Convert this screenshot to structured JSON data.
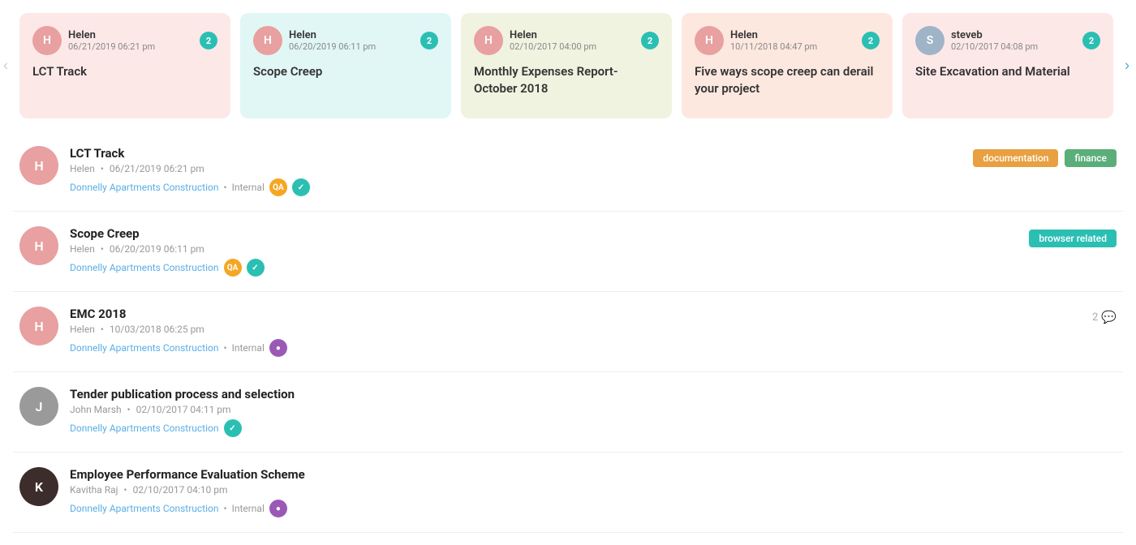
{
  "carousel": {
    "cards": [
      {
        "id": "card-1",
        "user": "Helen",
        "date": "06/21/2019 06:21 pm",
        "title": "LCT Track",
        "badge": "2",
        "bg": "card-pink",
        "avatarColor": "#E8A0A0",
        "avatarInitial": "H"
      },
      {
        "id": "card-2",
        "user": "Helen",
        "date": "06/20/2019 06:11 pm",
        "title": "Scope Creep",
        "badge": "2",
        "bg": "card-teal",
        "avatarColor": "#E8A0A0",
        "avatarInitial": "H"
      },
      {
        "id": "card-3",
        "user": "Helen",
        "date": "02/10/2017 04:00 pm",
        "title": "Monthly Expenses Report- October 2018",
        "badge": "2",
        "bg": "card-olive",
        "avatarColor": "#E8A0A0",
        "avatarInitial": "H"
      },
      {
        "id": "card-4",
        "user": "Helen",
        "date": "10/11/2018 04:47 pm",
        "title": "Five ways scope creep can derail your project",
        "badge": "2",
        "bg": "card-peach",
        "avatarColor": "#E8A0A0",
        "avatarInitial": "H"
      },
      {
        "id": "card-5",
        "user": "steveb",
        "date": "02/10/2017 04:08 pm",
        "title": "Site Excavation and Material",
        "badge": "2",
        "bg": "card-pink2",
        "avatarColor": "#A0B4C8",
        "avatarInitial": "S"
      }
    ]
  },
  "list": {
    "items": [
      {
        "id": "item-1",
        "title": "LCT Track",
        "user": "Helen",
        "date": "06/21/2019 06:21 pm",
        "project": "Donnelly Apartments Construction",
        "internal": true,
        "avatarColor": "#E8A0A0",
        "avatarInitial": "H",
        "pills": [
          {
            "label": "QA",
            "color": "pill-orange"
          },
          {
            "label": "",
            "color": "pill-teal",
            "icon": "✓"
          }
        ],
        "tags": [
          {
            "label": "documentation",
            "class": "tag-documentation"
          },
          {
            "label": "finance",
            "class": "tag-finance"
          }
        ],
        "comments": null
      },
      {
        "id": "item-2",
        "title": "Scope Creep",
        "user": "Helen",
        "date": "06/20/2019 06:11 pm",
        "project": "Donnelly Apartments Construction",
        "internal": false,
        "avatarColor": "#E8A0A0",
        "avatarInitial": "H",
        "pills": [
          {
            "label": "QA",
            "color": "pill-orange"
          },
          {
            "label": "",
            "color": "pill-teal",
            "icon": "✓"
          }
        ],
        "tags": [
          {
            "label": "browser related",
            "class": "tag-browser"
          }
        ],
        "comments": null
      },
      {
        "id": "item-3",
        "title": "EMC 2018",
        "user": "Helen",
        "date": "10/03/2018 06:25 pm",
        "project": "Donnelly Apartments Construction",
        "internal": true,
        "avatarColor": "#E8A0A0",
        "avatarInitial": "H",
        "pills": [
          {
            "label": "",
            "color": "pill-purple",
            "icon": "♦"
          }
        ],
        "tags": [],
        "comments": "2"
      },
      {
        "id": "item-4",
        "title": "Tender publication process and selection",
        "user": "John Marsh",
        "date": "02/10/2017 04:11 pm",
        "project": "Donnelly Apartments Construction",
        "internal": false,
        "avatarColor": "#B0B0B0",
        "avatarInitial": "J",
        "isGrayAvatar": true,
        "pills": [
          {
            "label": "",
            "color": "pill-teal",
            "icon": "✓"
          }
        ],
        "tags": [],
        "comments": null
      },
      {
        "id": "item-5",
        "title": "Employee Performance Evaluation Scheme",
        "user": "Kavitha Raj",
        "date": "02/10/2017 04:10 pm",
        "project": "Donnelly Apartments Construction",
        "internal": true,
        "avatarColor": "#3D2C2C",
        "avatarInitial": "K",
        "isDarkAvatar": true,
        "pills": [
          {
            "label": "",
            "color": "pill-purple",
            "icon": "♦"
          }
        ],
        "tags": [],
        "comments": null
      }
    ]
  },
  "nav": {
    "prevArrow": "‹",
    "nextArrow": "›"
  }
}
